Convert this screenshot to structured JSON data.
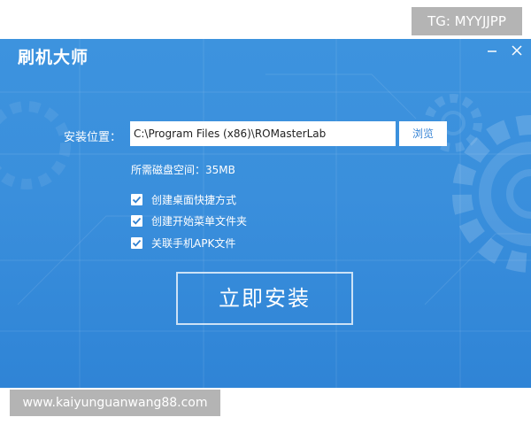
{
  "watermarks": {
    "top_right": "TG: MYYJJPP",
    "bottom_left": "www.kaiyunguanwang88.com"
  },
  "window": {
    "title": "刷机大师",
    "minimize_icon": "minimize-icon",
    "close_icon": "close-icon"
  },
  "install": {
    "location_label": "安装位置：",
    "path_value": "C:\\Program Files (x86)\\ROMasterLab",
    "browse_label": "浏览",
    "disk_space": "所需磁盘空间：35MB",
    "options": [
      {
        "label": "创建桌面快捷方式",
        "checked": true
      },
      {
        "label": "创建开始菜单文件夹",
        "checked": true
      },
      {
        "label": "关联手机APK文件",
        "checked": true
      }
    ],
    "install_button": "立即安装"
  },
  "colors": {
    "window_bg": "#3a8fdc",
    "checkmark": "#2f80d0",
    "browse_text": "#3a86d6",
    "watermark_bg": "#b4b4b4"
  }
}
